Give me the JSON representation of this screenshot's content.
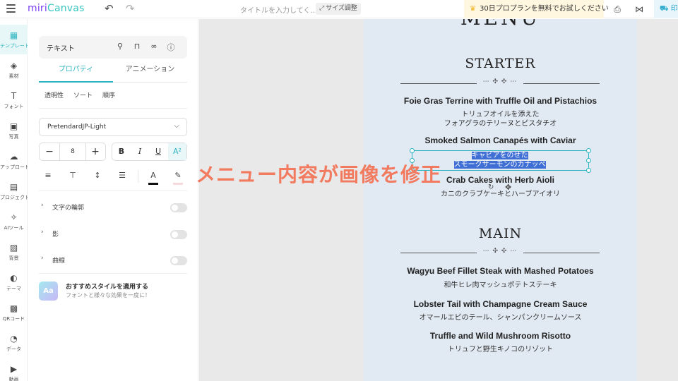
{
  "app": {
    "logo_part1": "miri",
    "logo_part2": "Canvas",
    "title_placeholder": "タイトルを入力してく...",
    "resize_label": "サイズ調整",
    "promo_label": "30日プロプランを無料でお試しください",
    "print_label": "印",
    "accent_color": "#2bb3c0"
  },
  "rail": {
    "items": [
      {
        "label": "テンプレート",
        "icon": "template-icon"
      },
      {
        "label": "素材",
        "icon": "elements-icon"
      },
      {
        "label": "フォント",
        "icon": "font-icon"
      },
      {
        "label": "写真",
        "icon": "photo-icon"
      },
      {
        "label": "アップロード",
        "icon": "upload-icon"
      },
      {
        "label": "プロジェクト",
        "icon": "project-icon"
      },
      {
        "label": "AIツール",
        "icon": "ai-tools-icon"
      },
      {
        "label": "背景",
        "icon": "background-icon"
      },
      {
        "label": "テーマ",
        "icon": "theme-icon"
      },
      {
        "label": "QRコード",
        "icon": "qr-code-icon"
      },
      {
        "label": "データ",
        "icon": "data-icon"
      },
      {
        "label": "動画",
        "icon": "video-icon"
      }
    ]
  },
  "panel": {
    "element_label": "テキスト",
    "tabs": [
      "プロパティ",
      "アニメーション"
    ],
    "subtabs": [
      "透明性",
      "ソート",
      "順序"
    ],
    "font_family": "PretendardJP-Light",
    "font_size": "8",
    "toggles": [
      "文字の輪郭",
      "影",
      "曲線"
    ],
    "recommend_badge": "Aa",
    "recommend_title": "おすすめスタイルを適用する",
    "recommend_desc": "フォントと様々な効果を一度に！"
  },
  "menu": {
    "title_partial": "MENU",
    "starter_heading": "STARTER",
    "main_heading": "MAIN",
    "starter_dishes": [
      {
        "en": "Foie Gras Terrine with Truffle Oil and Pistachios",
        "jp1": "トリュフオイルを添えた",
        "jp2": "フォアグラのテリーヌとピスタチオ"
      },
      {
        "en": "Smoked Salmon Canapés with Caviar",
        "jp1": "キャビアをのせた",
        "jp2": "スモークサーモンのカナッペ"
      },
      {
        "en": "Crab Cakes with Herb Aioli",
        "jp1": "カニのクラブケーキとハーブアイオリ"
      }
    ],
    "main_dishes": [
      {
        "en": "Wagyu Beef Fillet Steak with Mashed Potatoes",
        "jp1": "和牛ヒレ肉マッシュポテトステーキ"
      },
      {
        "en": "Lobster Tail with Champagne Cream Sauce",
        "jp1": "オマールエビのテール、シャンパンクリームソース"
      },
      {
        "en": "Truffle and Wild Mushroom Risotto",
        "jp1": "トリュフと野生キノコのリゾット"
      }
    ]
  },
  "caption": "メニュー内容が画像を修正"
}
